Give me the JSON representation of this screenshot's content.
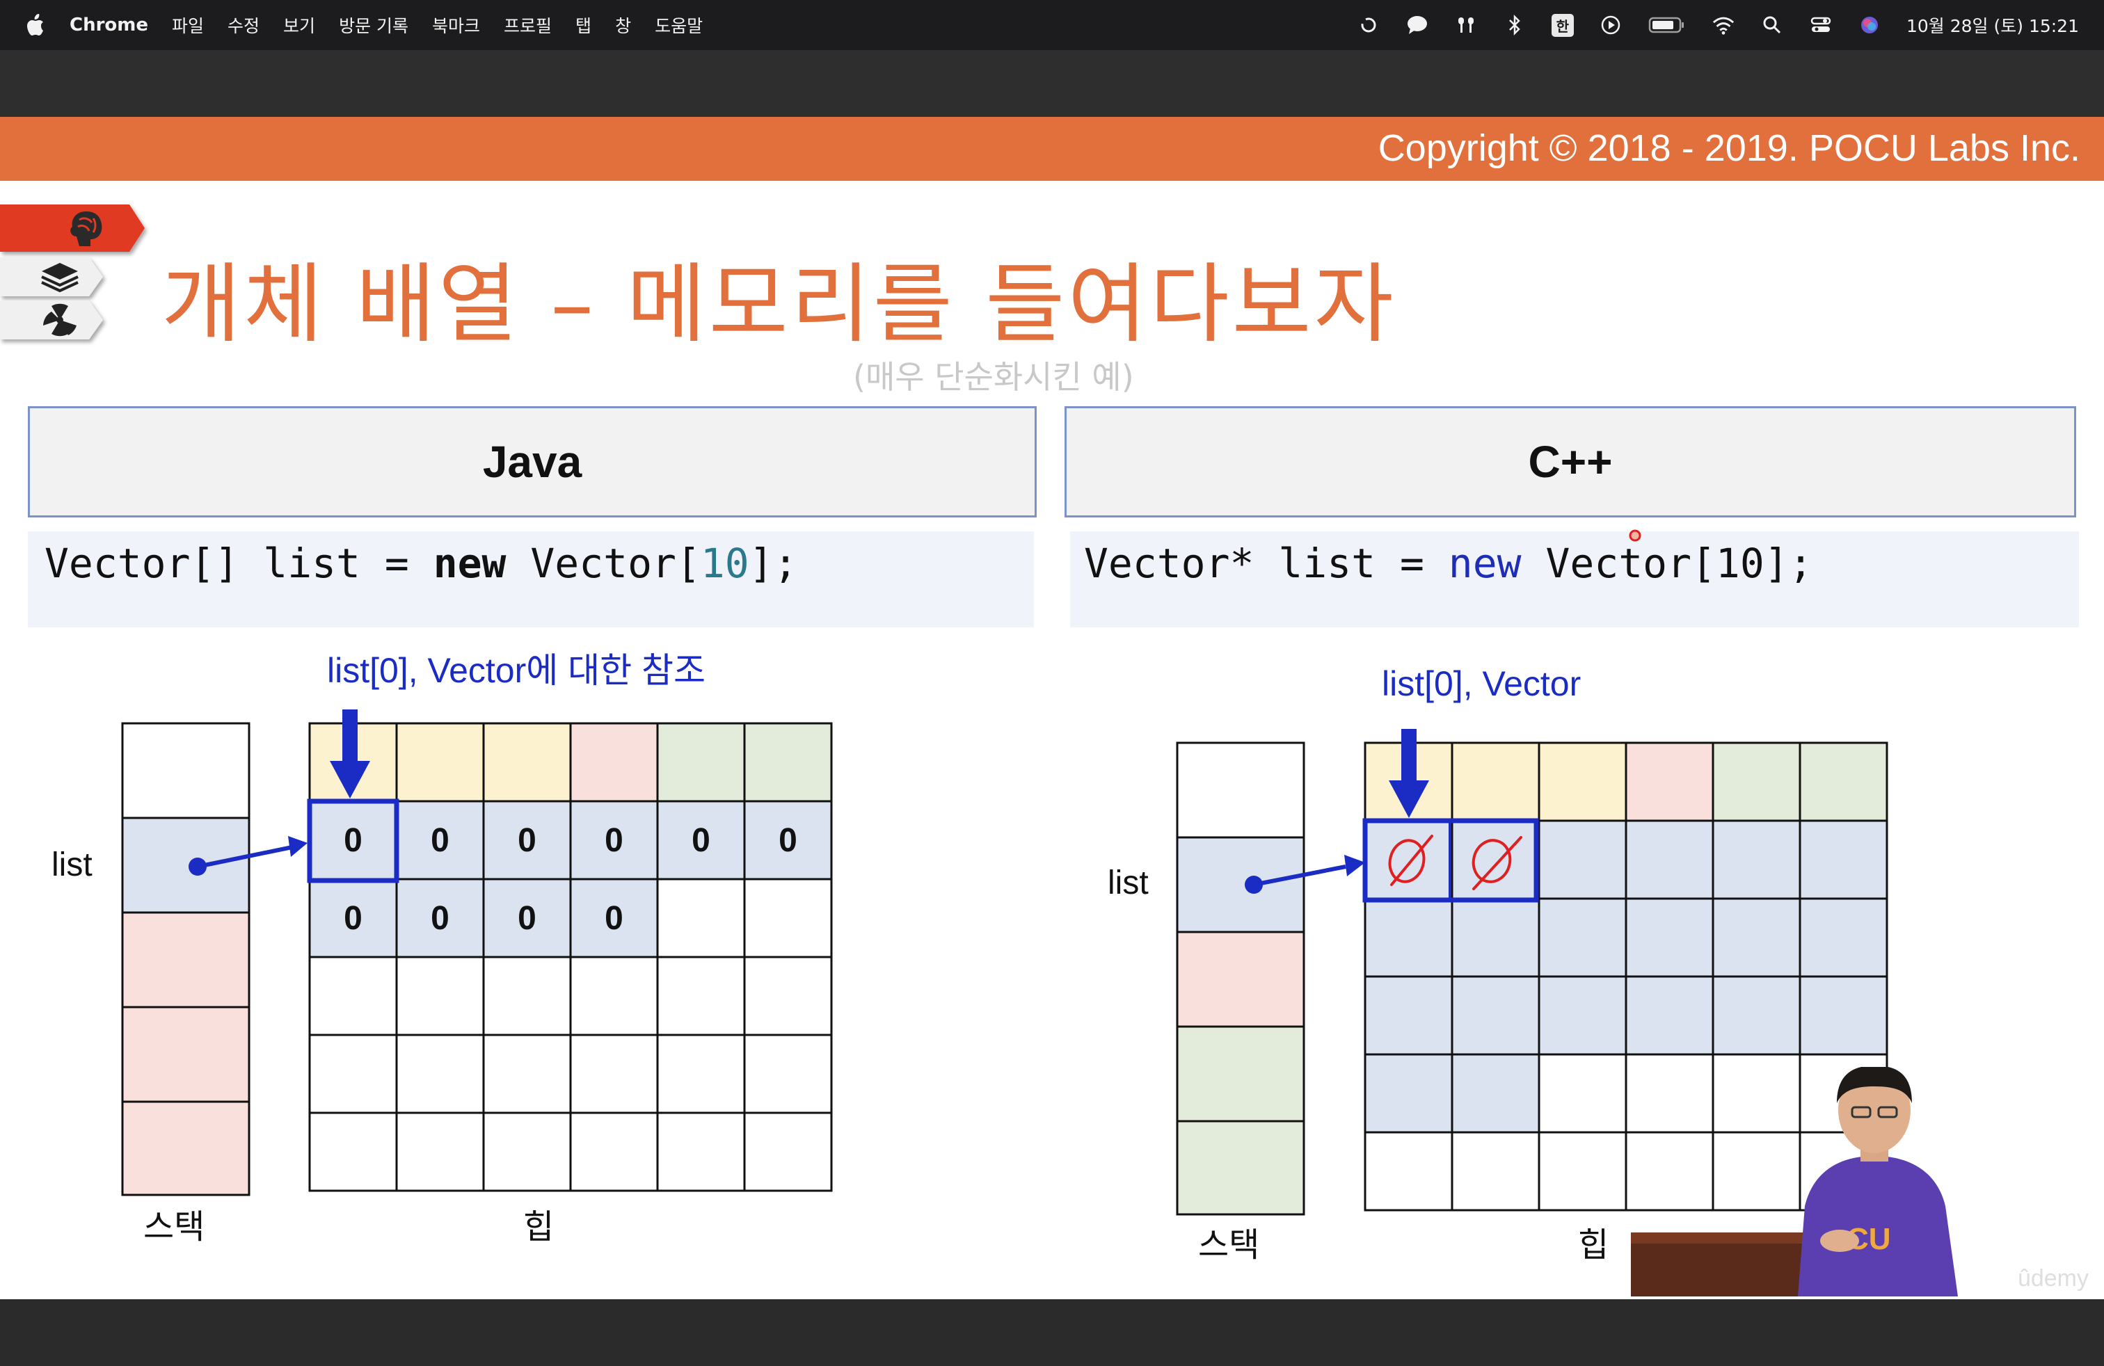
{
  "menubar": {
    "app_name": "Chrome",
    "menu_items": [
      "파일",
      "수정",
      "보기",
      "방문 기록",
      "북마크",
      "프로필",
      "탭",
      "창",
      "도움말"
    ],
    "ime_label": "한",
    "clock": "10월 28일 (토) 15:21"
  },
  "slide": {
    "copyright": "Copyright © 2018 - 2019. POCU Labs Inc.",
    "title": "개체 배열 – 메모리를 들여다보자",
    "subtitle": "(매우 단순화시킨 예)",
    "watermark": "ûdemy",
    "java": {
      "header": "Java",
      "code": {
        "p1": "Vector[] list = ",
        "kw": "new",
        "p2": " Vector[",
        "num": "10",
        "p3": "];"
      },
      "annotation": "list[0], Vector에 대한 참조",
      "list_label": "list",
      "stack_label": "스택",
      "heap_label": "힙",
      "heap_row1_values": [
        "0",
        "0",
        "0",
        "0",
        "0",
        "0"
      ],
      "heap_row2_values": [
        "0",
        "0",
        "0",
        "0"
      ]
    },
    "cpp": {
      "header": "C++",
      "code": {
        "p1": "Vector* list = ",
        "kw": "new",
        "p2": " Vector[10];"
      },
      "annotation": "list[0], Vector",
      "list_label": "list",
      "stack_label": "스택",
      "heap_label": "힙"
    }
  },
  "colors": {
    "accent_orange": "#e2703c",
    "heap_yellow": "#fdf2d0",
    "heap_pink": "#fae0dc",
    "heap_green": "#e3ecdb",
    "heap_blue": "#dce3f0",
    "pointer_blue": "#1a2cc4",
    "ink_red": "#e02020"
  }
}
